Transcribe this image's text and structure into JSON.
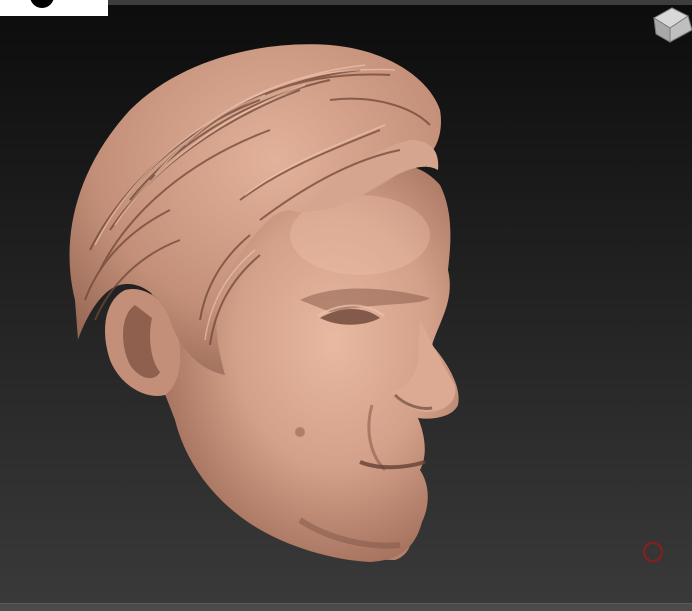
{
  "app": {
    "viewport_label": "",
    "subject": "sculpted head"
  },
  "colors": {
    "background_top": "#0c0c0c",
    "background_bottom": "#3a3a3a",
    "skin_base": "#c9977f",
    "skin_light": "#e6b49c",
    "skin_shadow": "#7e5646",
    "cursor": "#8a1e1e"
  },
  "icons": {
    "nav_cube": "navigation-cube-icon",
    "brush_cursor": "brush-cursor-icon"
  }
}
